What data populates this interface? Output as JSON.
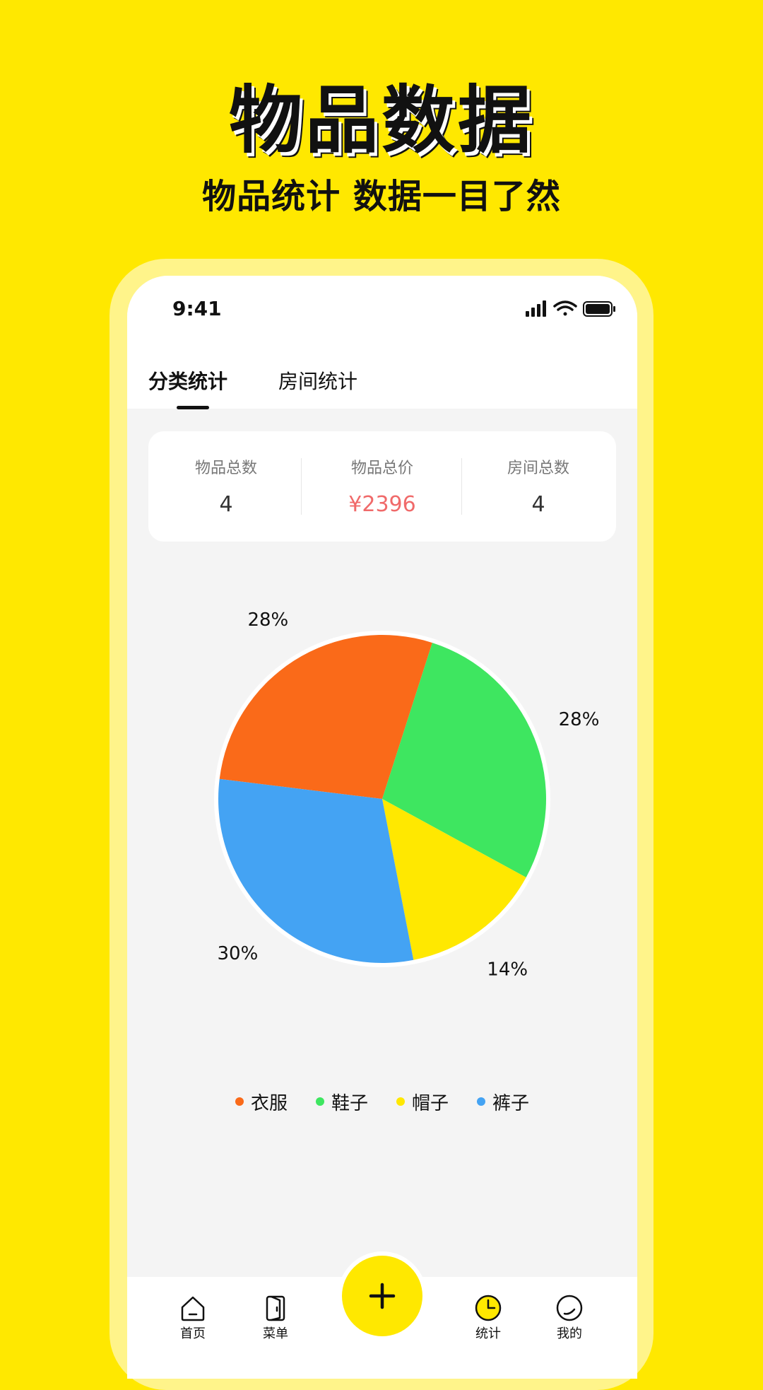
{
  "promo": {
    "title": "物品数据",
    "subtitle": "物品统计 数据一目了然"
  },
  "status_bar": {
    "time": "9:41"
  },
  "tabs": [
    {
      "label": "分类统计",
      "active": true
    },
    {
      "label": "房间统计",
      "active": false
    }
  ],
  "stats": {
    "total_items": {
      "label": "物品总数",
      "value": "4"
    },
    "total_price": {
      "label": "物品总价",
      "value": "¥2396"
    },
    "total_rooms": {
      "label": "房间总数",
      "value": "4"
    }
  },
  "chart_data": {
    "type": "pie",
    "categories": [
      "衣服",
      "鞋子",
      "帽子",
      "裤子"
    ],
    "values": [
      28,
      28,
      14,
      30
    ],
    "labels": [
      "28%",
      "28%",
      "14%",
      "30%"
    ],
    "colors": [
      "#FA6A19",
      "#3EE660",
      "#FFE800",
      "#44A3F3"
    ],
    "legend_position": "bottom"
  },
  "nav": {
    "home": "首页",
    "menu": "菜单",
    "stats": "统计",
    "mine": "我的"
  },
  "colors": {
    "background": "#FFE800",
    "accent": "#FFE800",
    "price": "#F06A6A"
  }
}
